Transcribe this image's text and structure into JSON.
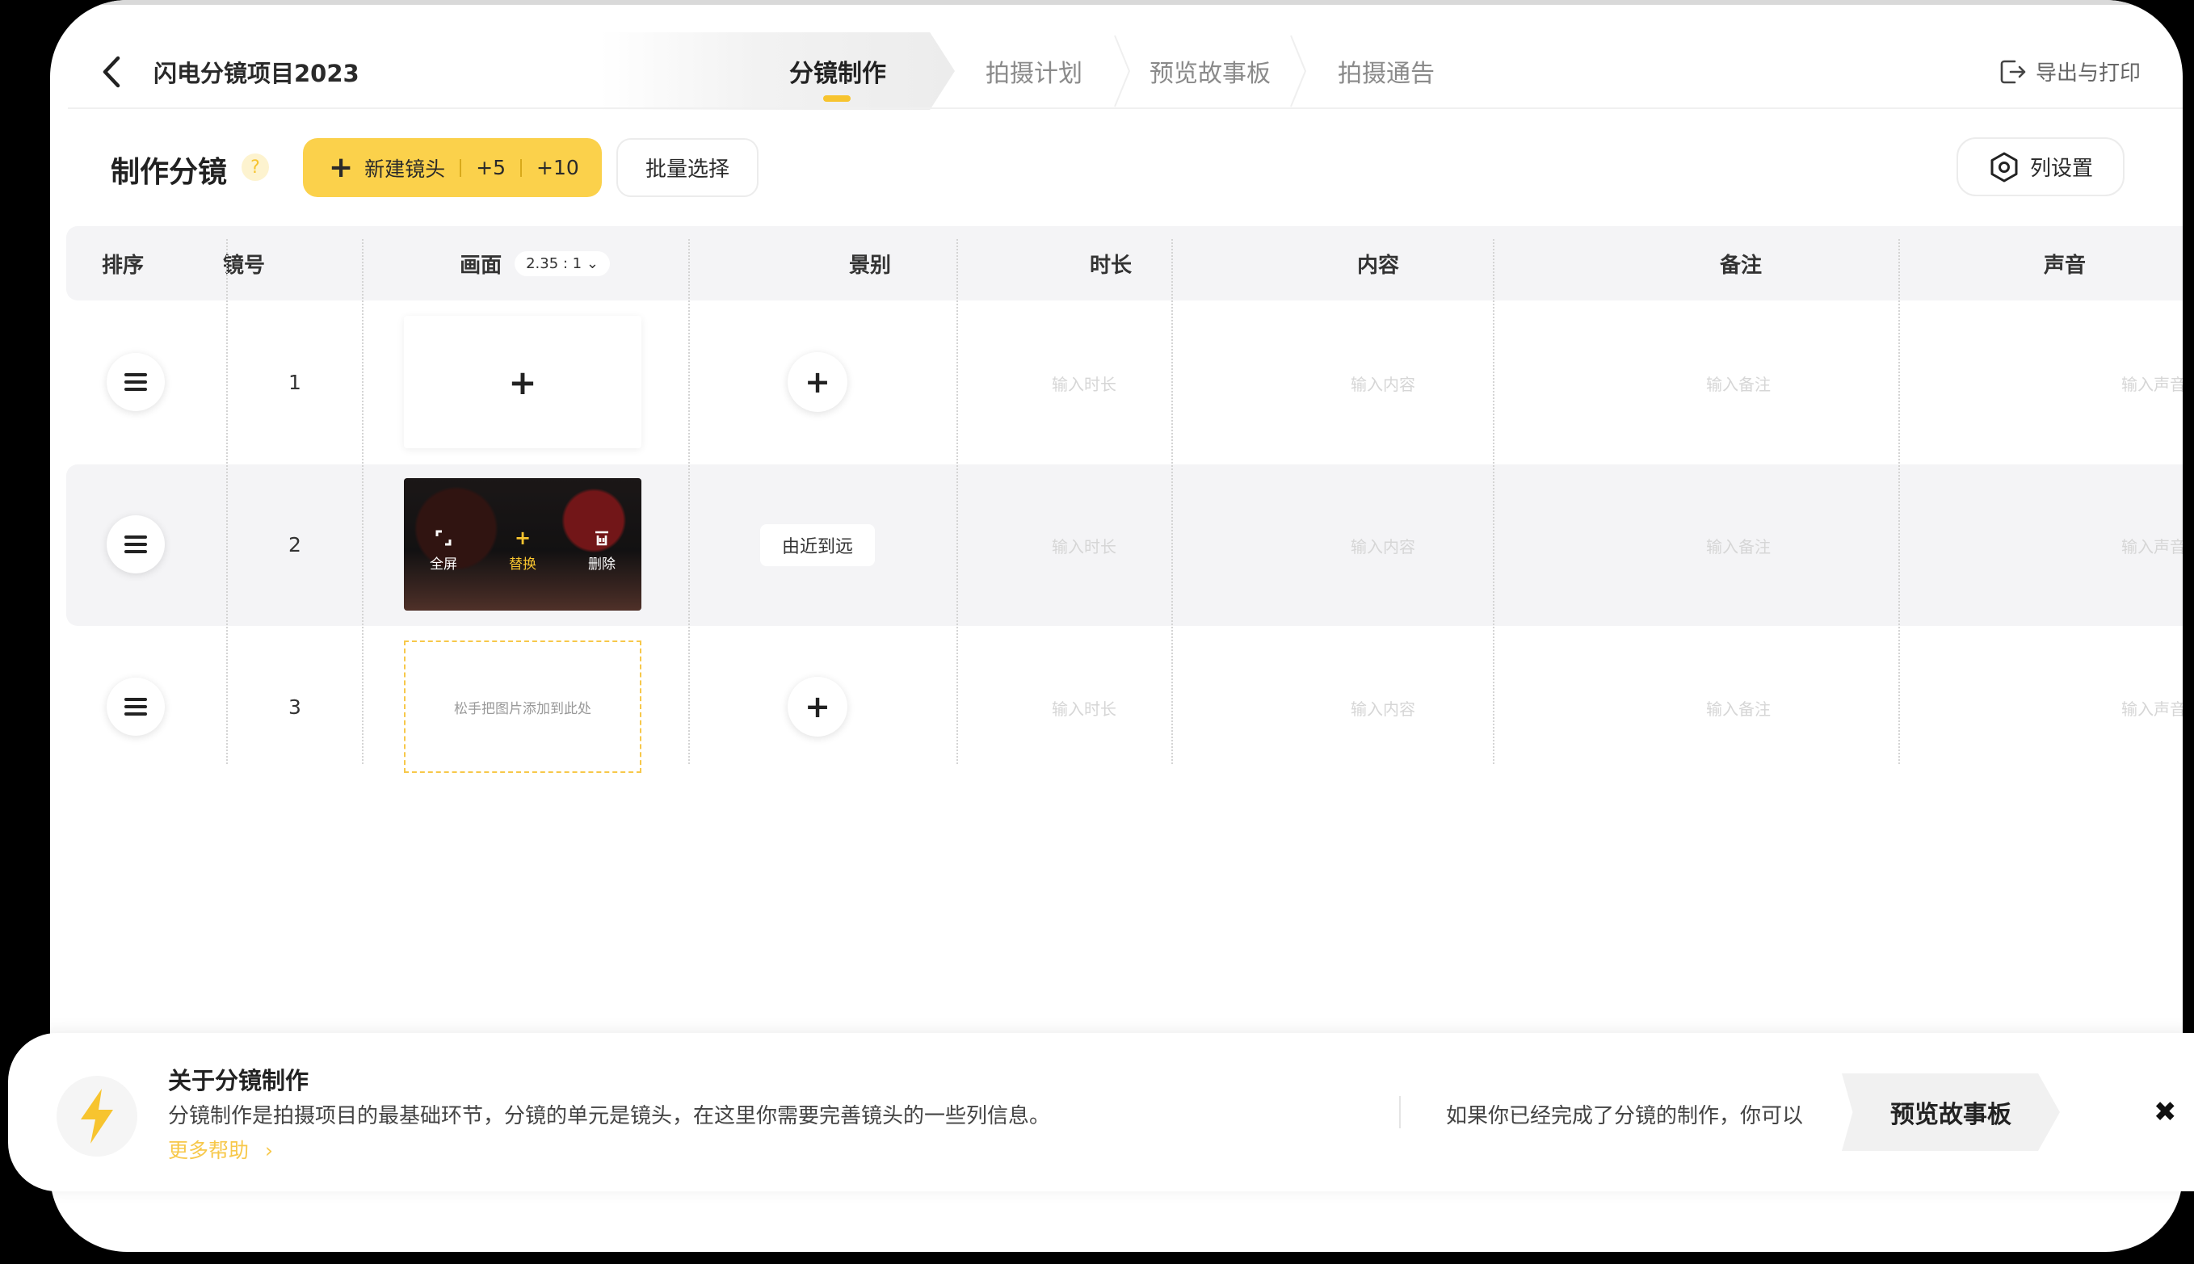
{
  "header": {
    "project_title": "闪电分镜项目2023",
    "tabs": [
      {
        "label": "分镜制作",
        "active": true
      },
      {
        "label": "拍摄计划",
        "active": false
      },
      {
        "label": "预览故事板",
        "active": false
      },
      {
        "label": "拍摄通告",
        "active": false
      }
    ],
    "export_label": "导出与打印"
  },
  "toolbar": {
    "title": "制作分镜",
    "help_icon": "?",
    "new_shot_label": "新建镜头",
    "add5_label": "+5",
    "add10_label": "+10",
    "batch_select_label": "批量选择",
    "column_settings_label": "列设置"
  },
  "table": {
    "columns": {
      "order": "排序",
      "shot_no": "镜号",
      "frame": "画面",
      "frame_ratio": "2.35 : 1",
      "shot_size": "景别",
      "duration": "时长",
      "content": "内容",
      "notes": "备注",
      "sound": "声音"
    },
    "placeholders": {
      "duration": "输入时长",
      "content": "输入内容",
      "notes": "输入备注",
      "sound": "输入声音"
    },
    "rows": [
      {
        "number": "1",
        "frame": "empty",
        "shot_size": ""
      },
      {
        "number": "2",
        "frame": "image",
        "shot_size": "由近到远",
        "actions": {
          "fullscreen": "全屏",
          "replace": "替换",
          "delete": "删除"
        }
      },
      {
        "number": "3",
        "frame": "drop",
        "drop_hint": "松手把图片添加到此处",
        "shot_size": ""
      }
    ]
  },
  "guide": {
    "title": "关于分镜制作",
    "description": "分镜制作是拍摄项目的最基础环节，分镜的单元是镜头，在这里你需要完善镜头的一些列信息。",
    "more_help": "更多帮助",
    "hint": "如果你已经完成了分镜的制作，你可以",
    "preview_button": "预览故事板",
    "close": "✖"
  },
  "colors": {
    "accent": "#f7c42f",
    "button_yellow": "#fbd14b",
    "header_bg": "#f4f4f6",
    "placeholder": "#d6d6d6"
  },
  "icons": [
    "back-chevron-icon",
    "export-icon",
    "question-icon",
    "plus-icon",
    "settings-hex-icon",
    "drag-handle-icon",
    "fullscreen-icon",
    "delete-icon",
    "lightning-bolt-icon",
    "close-icon"
  ]
}
